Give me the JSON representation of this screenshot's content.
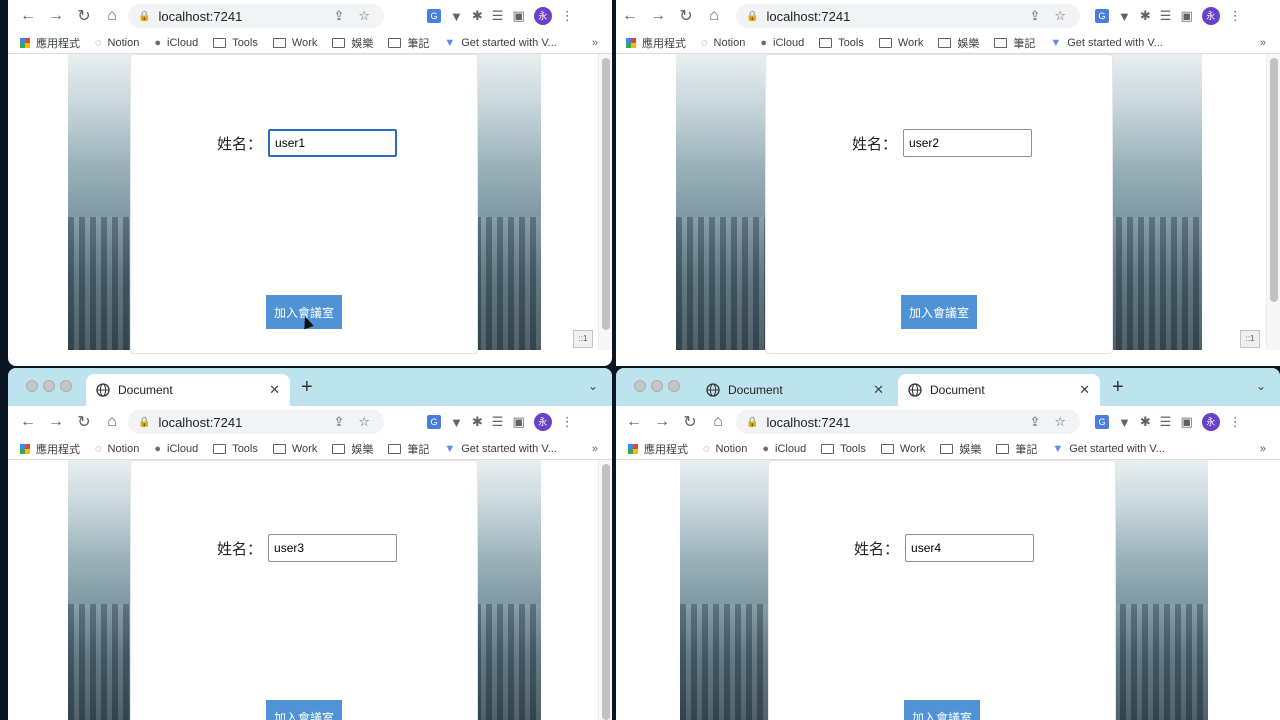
{
  "browser": {
    "url": "localhost:7241",
    "tab_title": "Document",
    "profile_initial": "永",
    "bookmarks": [
      "應用程式",
      "Notion",
      "iCloud",
      "Tools",
      "Work",
      "娛樂",
      "筆記",
      "Get started with V..."
    ],
    "bookmarks_more": "»"
  },
  "page": {
    "name_label": "姓名：",
    "join_button": "加入會議室",
    "resize_label": "::1"
  },
  "windows": [
    {
      "user_value": "user1"
    },
    {
      "user_value": "user2"
    },
    {
      "user_value": "user3"
    },
    {
      "user_value": "user4"
    }
  ],
  "colors": {
    "tabstrip": "#bde3ee",
    "button": "#4f93d6",
    "focus_ring": "#2e6bc6"
  }
}
